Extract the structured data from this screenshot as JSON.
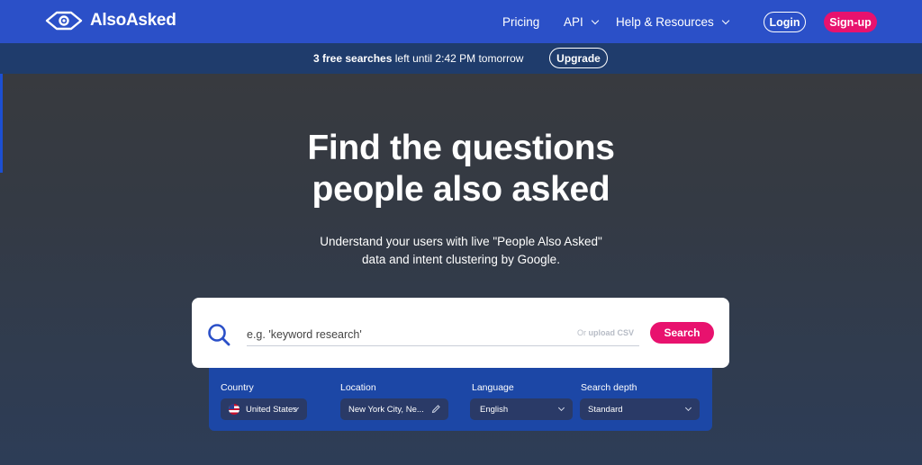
{
  "header": {
    "brand": "AlsoAsked",
    "nav": {
      "pricing": "Pricing",
      "api": "API",
      "help": "Help & Resources"
    },
    "login": "Login",
    "signup": "Sign-up"
  },
  "banner": {
    "searches_bold": "3 free searches",
    "searches_rest": " left until 2:42 PM tomorrow",
    "upgrade": "Upgrade"
  },
  "hero": {
    "title_line1": "Find the questions",
    "title_line2": "people also asked",
    "subtitle_line1": "Understand your users with live \"People Also Asked\"",
    "subtitle_line2": "data and intent clustering by Google."
  },
  "search": {
    "placeholder": "e.g. 'keyword research'",
    "upload_or": "Or",
    "upload_label": "upload CSV",
    "button": "Search"
  },
  "options": {
    "country": {
      "label": "Country",
      "value": "United States"
    },
    "location": {
      "label": "Location",
      "value": "New York City, Ne..."
    },
    "language": {
      "label": "Language",
      "value": "English"
    },
    "depth": {
      "label": "Search depth",
      "value": "Standard"
    }
  },
  "colors": {
    "header_bg": "#2b50c8",
    "banner_bg": "#1f3c6c",
    "accent_pink": "#e8126e",
    "options_bg": "#1c47a6"
  },
  "icons": [
    "eye-logo-icon",
    "chevron-down-icon",
    "search-icon",
    "us-flag-icon",
    "pencil-icon"
  ]
}
